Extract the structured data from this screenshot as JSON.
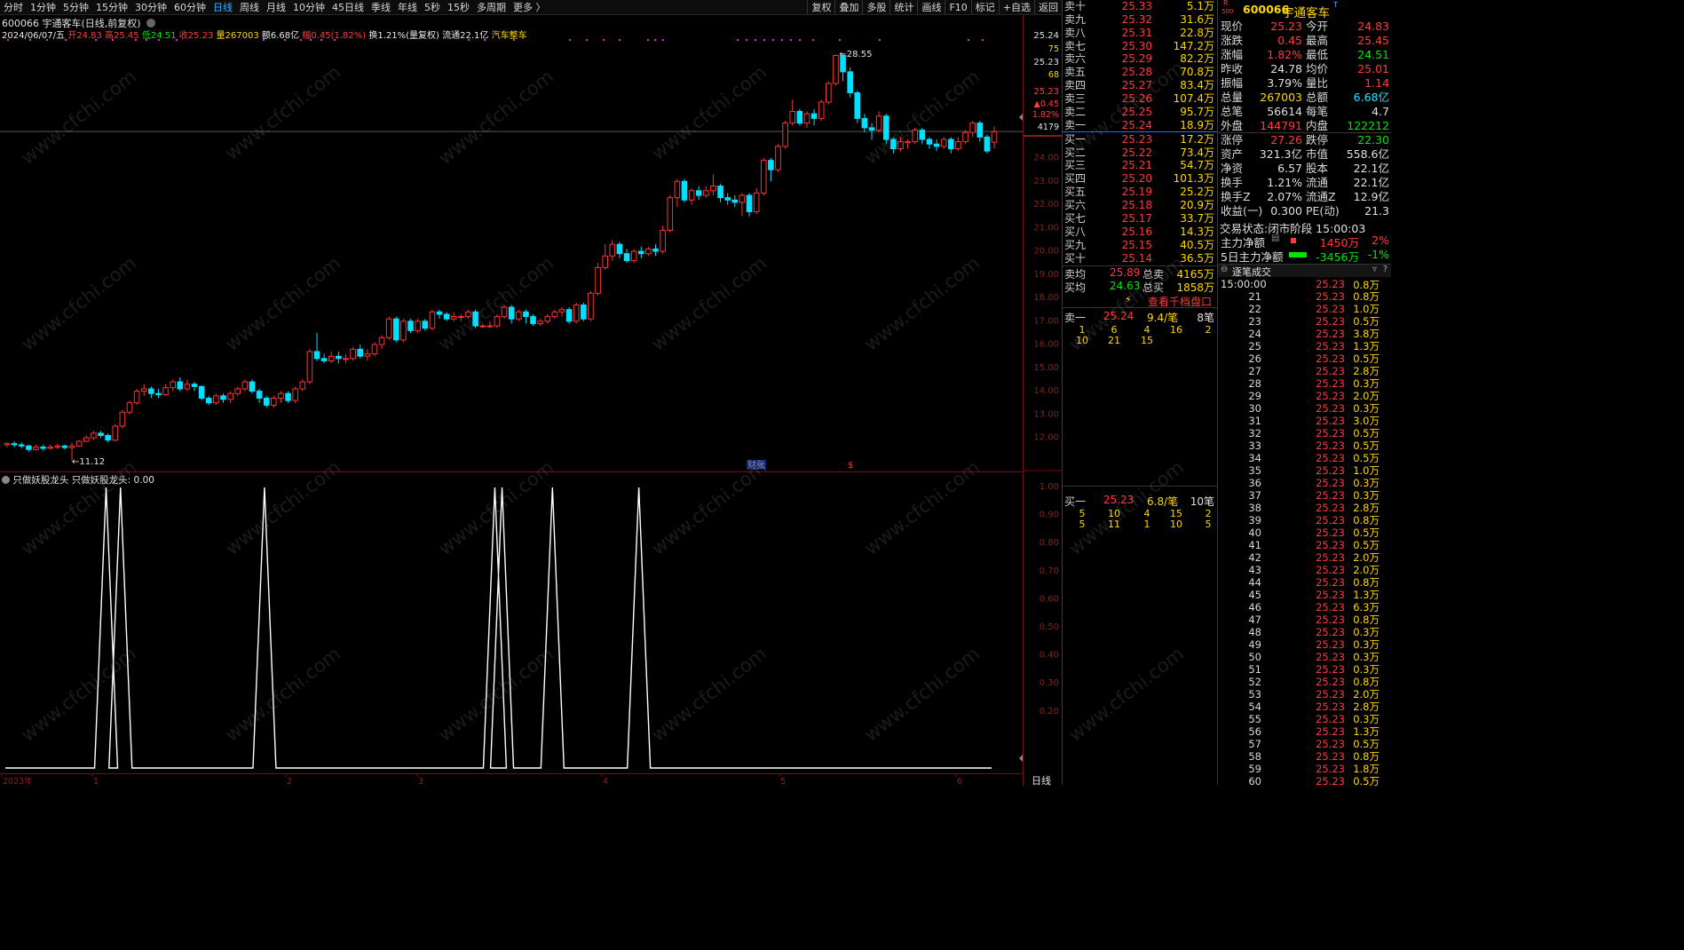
{
  "toolbar": {
    "periods": [
      "分时",
      "1分钟",
      "5分钟",
      "15分钟",
      "30分钟",
      "60分钟",
      "日线",
      "周线",
      "月线",
      "10分钟",
      "45日线",
      "季线",
      "年线",
      "5秒",
      "15秒",
      "多周期",
      "更多 〉"
    ],
    "active": "日线",
    "right": [
      "复权",
      "叠加",
      "多股",
      "统计",
      "画线",
      "F10",
      "标记",
      "+自选",
      "返回"
    ]
  },
  "stock": {
    "code": "600066",
    "name": "宇通客车",
    "mode": "(日线,前复权)",
    "tag": "汽车整车",
    "date": "2024/06/07/五",
    "open": "开24.83",
    "high": "高25.45",
    "low": "低24.51",
    "close": "收25.23",
    "vol": "量267003",
    "amt": "额6.68亿",
    "chg": "幅0.45(1.82%)",
    "turn": "换1.21%(量复权)",
    "float": "流通22.1亿"
  },
  "chart_data": {
    "type": "candlestick",
    "title": "600066 宇通客车 (日线,前复权)",
    "y_range": [
      11.0,
      28.9
    ],
    "y_ticks": [
      "25.24",
      "25.23",
      "25.23",
      "24.00",
      "23.00",
      "22.00",
      "21.00",
      "20.00",
      "19.00",
      "18.00",
      "17.00",
      "16.00",
      "15.00",
      "14.00",
      "13.00",
      "12.00"
    ],
    "price_markers": [
      {
        "price": 25.24,
        "label": "25.24"
      },
      {
        "price": 25.23,
        "label": "25.23"
      }
    ],
    "y_extra_labels": [
      "75",
      "68",
      "▲0.45",
      "1.82%",
      "4179"
    ],
    "annotations": [
      {
        "text": "28.55",
        "type": "high"
      },
      {
        "text": "11.12",
        "type": "low"
      }
    ],
    "events": [
      "财张",
      "$"
    ],
    "x_labels": [
      "2023年",
      "1",
      "2",
      "3",
      "4",
      "5",
      "6"
    ],
    "candles": [
      [
        11.8,
        11.85,
        11.9,
        11.7
      ],
      [
        11.85,
        11.8,
        11.95,
        11.7
      ],
      [
        11.8,
        11.75,
        11.9,
        11.65
      ],
      [
        11.75,
        11.6,
        11.8,
        11.5
      ],
      [
        11.6,
        11.7,
        11.8,
        11.55
      ],
      [
        11.7,
        11.65,
        11.8,
        11.55
      ],
      [
        11.65,
        11.7,
        11.8,
        11.6
      ],
      [
        11.7,
        11.75,
        11.85,
        11.62
      ],
      [
        11.75,
        11.68,
        11.8,
        11.6
      ],
      [
        11.68,
        11.75,
        11.9,
        11.12
      ],
      [
        11.75,
        11.95,
        12.0,
        11.7
      ],
      [
        11.95,
        12.1,
        12.2,
        11.9
      ],
      [
        12.1,
        12.3,
        12.4,
        12.0
      ],
      [
        12.3,
        12.2,
        12.4,
        12.1
      ],
      [
        12.2,
        12.0,
        12.3,
        11.9
      ],
      [
        12.0,
        12.6,
        12.7,
        11.95
      ],
      [
        12.6,
        13.2,
        13.3,
        12.5
      ],
      [
        13.2,
        13.6,
        13.7,
        13.1
      ],
      [
        13.6,
        14.1,
        14.2,
        13.5
      ],
      [
        14.1,
        14.2,
        14.4,
        13.9
      ],
      [
        14.2,
        14.0,
        14.3,
        13.8
      ],
      [
        14.0,
        13.95,
        14.2,
        13.8
      ],
      [
        13.95,
        14.25,
        14.4,
        13.9
      ],
      [
        14.25,
        14.5,
        14.6,
        14.1
      ],
      [
        14.5,
        14.2,
        14.7,
        14.1
      ],
      [
        14.2,
        14.4,
        14.6,
        14.1
      ],
      [
        14.4,
        14.3,
        14.5,
        14.1
      ],
      [
        14.3,
        13.8,
        14.35,
        13.7
      ],
      [
        13.8,
        13.6,
        13.9,
        13.5
      ],
      [
        13.6,
        13.9,
        14.0,
        13.5
      ],
      [
        13.9,
        13.75,
        14.0,
        13.6
      ],
      [
        13.75,
        14.0,
        14.1,
        13.6
      ],
      [
        14.0,
        14.2,
        14.3,
        13.9
      ],
      [
        14.2,
        14.5,
        14.6,
        14.1
      ],
      [
        14.5,
        14.1,
        14.6,
        14.0
      ],
      [
        14.1,
        13.8,
        14.2,
        13.6
      ],
      [
        13.8,
        13.5,
        13.9,
        13.4
      ],
      [
        13.5,
        13.8,
        13.9,
        13.4
      ],
      [
        13.8,
        14.0,
        14.1,
        13.6
      ],
      [
        14.0,
        13.7,
        14.1,
        13.6
      ],
      [
        13.7,
        14.2,
        14.3,
        13.6
      ],
      [
        14.2,
        14.5,
        14.6,
        14.1
      ],
      [
        14.5,
        15.8,
        15.9,
        14.4
      ],
      [
        15.8,
        15.5,
        16.6,
        15.4
      ],
      [
        15.5,
        15.4,
        15.7,
        15.3
      ],
      [
        15.4,
        15.6,
        15.8,
        15.3
      ],
      [
        15.6,
        15.5,
        15.8,
        15.3
      ],
      [
        15.5,
        15.5,
        15.7,
        15.3
      ],
      [
        15.5,
        15.9,
        16.0,
        15.4
      ],
      [
        15.9,
        15.6,
        16.1,
        15.5
      ],
      [
        15.6,
        15.7,
        15.9,
        15.4
      ],
      [
        15.7,
        16.1,
        16.2,
        15.6
      ],
      [
        16.1,
        16.4,
        16.5,
        15.9
      ],
      [
        16.4,
        17.2,
        17.3,
        16.3
      ],
      [
        17.2,
        16.3,
        17.3,
        16.2
      ],
      [
        16.3,
        17.1,
        17.2,
        16.2
      ],
      [
        17.1,
        16.7,
        17.2,
        16.6
      ],
      [
        16.7,
        17.1,
        17.2,
        16.6
      ],
      [
        17.1,
        16.8,
        17.2,
        16.7
      ],
      [
        16.8,
        17.5,
        17.6,
        16.7
      ],
      [
        17.5,
        17.4,
        17.6,
        17.2
      ],
      [
        17.4,
        17.2,
        17.5,
        17.1
      ],
      [
        17.2,
        17.3,
        17.5,
        17.1
      ],
      [
        17.3,
        17.3,
        17.4,
        17.1
      ],
      [
        17.3,
        17.5,
        17.6,
        17.2
      ],
      [
        17.5,
        16.9,
        17.6,
        16.8
      ],
      [
        16.9,
        16.9,
        17.0,
        16.8
      ],
      [
        16.9,
        16.9,
        17.1,
        16.8
      ],
      [
        16.9,
        17.3,
        17.4,
        16.8
      ],
      [
        17.3,
        17.7,
        17.8,
        17.2
      ],
      [
        17.7,
        17.2,
        17.8,
        17.0
      ],
      [
        17.2,
        17.5,
        17.6,
        17.1
      ],
      [
        17.5,
        17.3,
        17.6,
        17.0
      ],
      [
        17.3,
        17.0,
        17.4,
        16.9
      ],
      [
        17.0,
        17.1,
        17.2,
        16.9
      ],
      [
        17.1,
        17.3,
        17.4,
        17.0
      ],
      [
        17.3,
        17.5,
        17.6,
        17.2
      ],
      [
        17.5,
        17.6,
        17.7,
        17.3
      ],
      [
        17.6,
        17.1,
        17.7,
        17.0
      ],
      [
        17.1,
        17.8,
        17.9,
        17.0
      ],
      [
        17.8,
        17.2,
        17.9,
        17.1
      ],
      [
        17.2,
        18.3,
        18.4,
        17.1
      ],
      [
        18.3,
        19.4,
        19.6,
        18.2
      ],
      [
        19.4,
        19.9,
        20.4,
        19.3
      ],
      [
        19.9,
        20.4,
        20.6,
        19.7
      ],
      [
        20.4,
        20.0,
        20.5,
        19.8
      ],
      [
        20.0,
        19.7,
        20.2,
        19.6
      ],
      [
        19.7,
        20.1,
        20.2,
        19.6
      ],
      [
        20.1,
        20.0,
        20.3,
        19.8
      ],
      [
        20.0,
        20.2,
        20.3,
        19.9
      ],
      [
        20.2,
        20.1,
        20.4,
        19.9
      ],
      [
        20.1,
        21.0,
        21.2,
        20.0
      ],
      [
        21.0,
        22.4,
        22.5,
        20.9
      ],
      [
        22.4,
        23.1,
        23.2,
        22.0
      ],
      [
        23.1,
        22.3,
        23.2,
        22.2
      ],
      [
        22.3,
        22.7,
        22.8,
        22.1
      ],
      [
        22.7,
        22.5,
        22.9,
        22.3
      ],
      [
        22.5,
        22.7,
        22.9,
        22.4
      ],
      [
        22.7,
        22.9,
        23.4,
        22.5
      ],
      [
        22.9,
        22.4,
        23.0,
        22.2
      ],
      [
        22.4,
        22.3,
        22.6,
        22.1
      ],
      [
        22.3,
        22.2,
        22.5,
        22.0
      ],
      [
        22.2,
        22.5,
        22.6,
        21.6
      ],
      [
        22.5,
        21.8,
        22.6,
        21.6
      ],
      [
        21.8,
        22.6,
        22.8,
        21.7
      ],
      [
        22.6,
        24.0,
        24.1,
        22.5
      ],
      [
        24.0,
        23.6,
        24.1,
        23.1
      ],
      [
        23.6,
        24.6,
        24.7,
        23.5
      ],
      [
        24.6,
        25.6,
        25.7,
        24.5
      ],
      [
        25.6,
        26.1,
        26.6,
        25.5
      ],
      [
        26.1,
        25.6,
        26.2,
        25.5
      ],
      [
        25.6,
        26.0,
        26.1,
        25.4
      ],
      [
        26.0,
        25.8,
        26.2,
        25.5
      ],
      [
        25.8,
        26.5,
        26.6,
        25.7
      ],
      [
        26.5,
        27.3,
        27.4,
        26.4
      ],
      [
        27.3,
        28.5,
        28.55,
        27.2
      ],
      [
        28.5,
        27.8,
        28.6,
        27.4
      ],
      [
        27.8,
        26.9,
        28.0,
        26.7
      ],
      [
        26.9,
        25.8,
        27.0,
        25.6
      ],
      [
        25.8,
        25.4,
        26.0,
        25.2
      ],
      [
        25.4,
        25.3,
        25.6,
        24.9
      ],
      [
        25.3,
        25.9,
        26.1,
        25.2
      ],
      [
        25.9,
        24.9,
        26.0,
        24.7
      ],
      [
        24.9,
        24.5,
        25.0,
        24.3
      ],
      [
        24.5,
        24.8,
        25.0,
        24.4
      ],
      [
        24.8,
        24.8,
        24.9,
        24.5
      ],
      [
        24.8,
        25.3,
        25.4,
        24.7
      ],
      [
        25.3,
        24.9,
        25.4,
        24.7
      ],
      [
        24.9,
        24.7,
        25.0,
        24.5
      ],
      [
        24.7,
        24.6,
        24.9,
        24.4
      ],
      [
        24.6,
        24.9,
        25.0,
        24.5
      ],
      [
        24.9,
        24.5,
        25.0,
        24.3
      ],
      [
        24.5,
        24.8,
        25.0,
        24.4
      ],
      [
        24.8,
        25.2,
        25.3,
        24.7
      ],
      [
        25.2,
        25.6,
        25.7,
        25.0
      ],
      [
        25.6,
        25.0,
        25.7,
        24.8
      ],
      [
        25.0,
        24.4,
        25.1,
        24.3
      ],
      [
        24.78,
        25.23,
        25.45,
        24.51
      ]
    ],
    "indicator": {
      "title": "只做妖股龙头",
      "value": "只做妖股龙头: 0.00",
      "y_ticks": [
        "1.00",
        "0.90",
        "0.80",
        "0.70",
        "0.60",
        "0.50",
        "0.40",
        "0.30",
        "0.20"
      ],
      "spike_bars": [
        14,
        16,
        36,
        68,
        69,
        76,
        88
      ]
    }
  },
  "orderbook": {
    "asks": [
      {
        "label": "卖十",
        "price": "25.33",
        "vol": "5.1万"
      },
      {
        "label": "卖九",
        "price": "25.32",
        "vol": "31.6万"
      },
      {
        "label": "卖八",
        "price": "25.31",
        "vol": "22.8万"
      },
      {
        "label": "卖七",
        "price": "25.30",
        "vol": "147.2万"
      },
      {
        "label": "卖六",
        "price": "25.29",
        "vol": "82.2万"
      },
      {
        "label": "卖五",
        "price": "25.28",
        "vol": "70.8万"
      },
      {
        "label": "卖四",
        "price": "25.27",
        "vol": "83.4万"
      },
      {
        "label": "卖三",
        "price": "25.26",
        "vol": "107.4万"
      },
      {
        "label": "卖二",
        "price": "25.25",
        "vol": "95.7万"
      },
      {
        "label": "卖一",
        "price": "25.24",
        "vol": "18.9万"
      }
    ],
    "bids": [
      {
        "label": "买一",
        "price": "25.23",
        "vol": "17.2万"
      },
      {
        "label": "买二",
        "price": "25.22",
        "vol": "73.4万"
      },
      {
        "label": "买三",
        "price": "25.21",
        "vol": "54.7万"
      },
      {
        "label": "买四",
        "price": "25.20",
        "vol": "101.3万"
      },
      {
        "label": "买五",
        "price": "25.19",
        "vol": "25.2万"
      },
      {
        "label": "买六",
        "price": "25.18",
        "vol": "20.9万"
      },
      {
        "label": "买七",
        "price": "25.17",
        "vol": "33.7万"
      },
      {
        "label": "买八",
        "price": "25.16",
        "vol": "14.3万"
      },
      {
        "label": "买九",
        "price": "25.15",
        "vol": "40.5万"
      },
      {
        "label": "买十",
        "price": "25.14",
        "vol": "36.5万"
      }
    ],
    "ask_avg_label": "卖均",
    "ask_avg": "25.89",
    "ask_total_label": "总卖",
    "ask_total": "4165万",
    "bid_avg_label": "买均",
    "bid_avg": "24.63",
    "bid_total_label": "总买",
    "bid_total": "1858万",
    "thousand_btn": "查看千档盘口",
    "sell1": {
      "label": "卖一",
      "price": "25.24",
      "per": "9.4/笔",
      "count": "8笔",
      "queue": [
        "1",
        "6",
        "4",
        "16",
        "2",
        "10",
        "21",
        "15"
      ]
    },
    "buy1": {
      "label": "买一",
      "price": "25.23",
      "per": "6.8/笔",
      "count": "10笔",
      "queue": [
        "5",
        "10",
        "4",
        "15",
        "2",
        "5",
        "11",
        "1",
        "10",
        "5"
      ]
    }
  },
  "quote": {
    "rows": [
      [
        "现价",
        "25.23",
        "今开",
        "24.83"
      ],
      [
        "涨跌",
        "0.45",
        "最高",
        "25.45"
      ],
      [
        "涨幅",
        "1.82%",
        "最低",
        "24.51"
      ],
      [
        "昨收",
        "24.78",
        "均价",
        "25.01"
      ],
      [
        "振幅",
        "3.79%",
        "量比",
        "1.14"
      ],
      [
        "总量",
        "267003",
        "总额",
        "6.68亿"
      ],
      [
        "总笔",
        "56614",
        "每笔",
        "4.7"
      ],
      [
        "外盘",
        "144791",
        "内盘",
        "122212"
      ],
      [
        "涨停",
        "27.26",
        "跌停",
        "22.30"
      ],
      [
        "资产",
        "321.3亿",
        "市值",
        "558.6亿"
      ],
      [
        "净资",
        "6.57",
        "股本",
        "22.1亿"
      ],
      [
        "换手",
        "1.21%",
        "流通",
        "22.1亿"
      ],
      [
        "换手Z",
        "2.07%",
        "流通Z",
        "12.9亿"
      ],
      [
        "收益(一)",
        "0.300",
        "PE(动)",
        "21.3"
      ]
    ],
    "status": "交易状态:闭市阶段 15:00:03",
    "main_flow_label": "主力净额",
    "main_flow": "1450万",
    "main_flow_pct": "2%",
    "flow5_label": "5日主力净额",
    "flow5": "-3456万",
    "flow5_pct": "-1%",
    "ticks_title": "逐笔成交",
    "ticks_time": "15:00:00",
    "ticks": [
      [
        "21",
        "0.8万"
      ],
      [
        "22",
        "1.0万"
      ],
      [
        "23",
        "0.5万"
      ],
      [
        "24",
        "3.8万"
      ],
      [
        "25",
        "1.3万"
      ],
      [
        "26",
        "0.5万"
      ],
      [
        "27",
        "2.8万"
      ],
      [
        "28",
        "0.3万"
      ],
      [
        "29",
        "2.0万"
      ],
      [
        "30",
        "0.3万"
      ],
      [
        "31",
        "3.0万"
      ],
      [
        "32",
        "0.5万"
      ],
      [
        "33",
        "0.5万"
      ],
      [
        "34",
        "0.5万"
      ],
      [
        "35",
        "1.0万"
      ],
      [
        "36",
        "0.3万"
      ],
      [
        "37",
        "0.3万"
      ],
      [
        "38",
        "2.8万"
      ],
      [
        "39",
        "0.8万"
      ],
      [
        "40",
        "0.5万"
      ],
      [
        "41",
        "0.5万"
      ],
      [
        "42",
        "2.0万"
      ],
      [
        "43",
        "2.0万"
      ],
      [
        "44",
        "0.8万"
      ],
      [
        "45",
        "1.3万"
      ],
      [
        "46",
        "6.3万"
      ],
      [
        "47",
        "0.8万"
      ],
      [
        "48",
        "0.3万"
      ],
      [
        "49",
        "0.3万"
      ],
      [
        "50",
        "0.3万"
      ],
      [
        "51",
        "0.3万"
      ],
      [
        "52",
        "0.8万"
      ],
      [
        "53",
        "2.0万"
      ],
      [
        "54",
        "2.8万"
      ],
      [
        "55",
        "0.3万"
      ],
      [
        "56",
        "1.3万"
      ],
      [
        "57",
        "0.5万"
      ],
      [
        "58",
        "0.8万"
      ],
      [
        "59",
        "1.8万"
      ],
      [
        "60",
        "0.5万"
      ]
    ],
    "tick_price": "25.23"
  },
  "watermark": "www.cfchi.com"
}
